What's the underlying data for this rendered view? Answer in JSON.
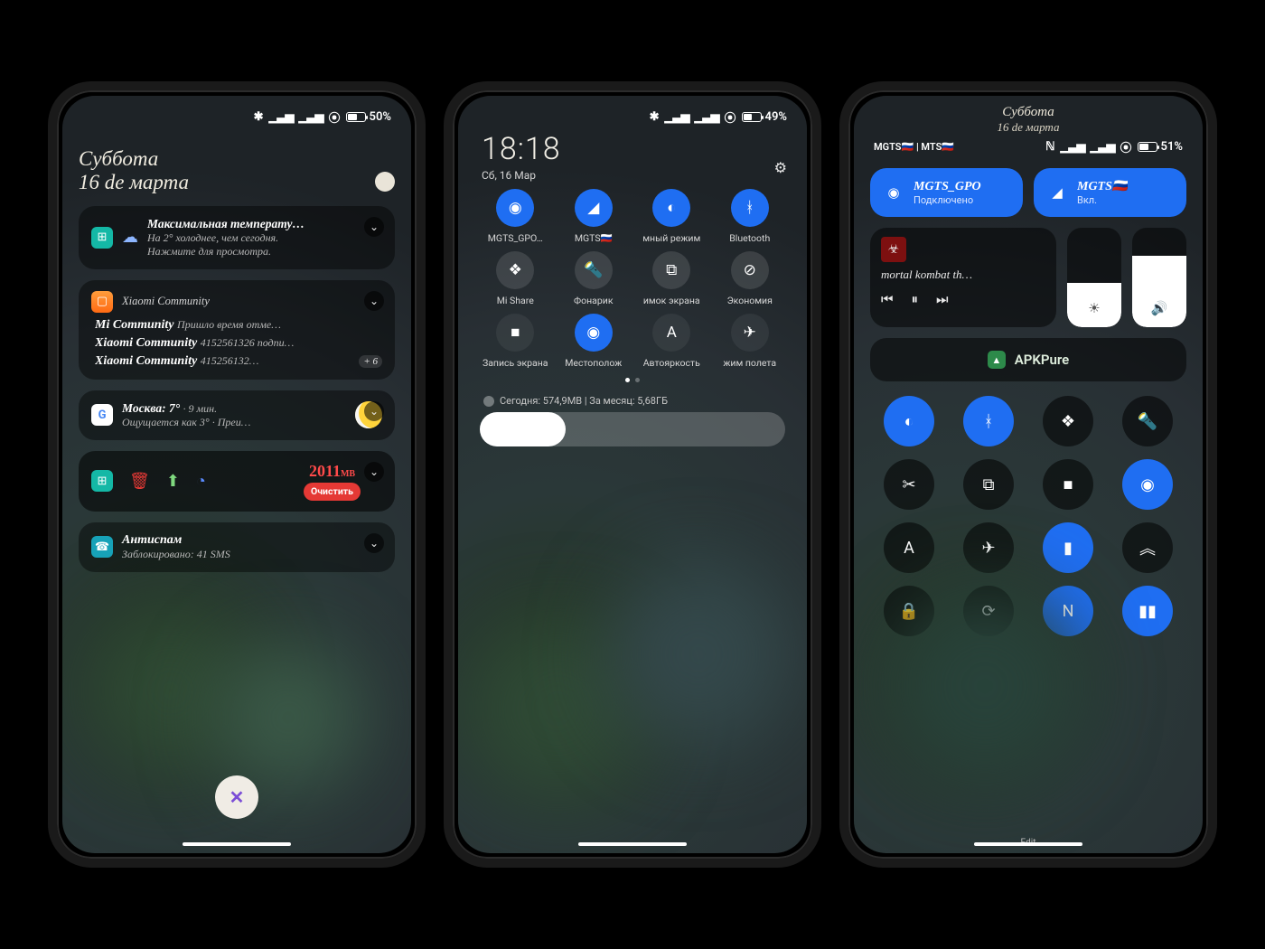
{
  "phone1": {
    "status": {
      "battery": "50%",
      "fill": 50
    },
    "date": {
      "day": "Суббота",
      "line2": "16 de марта"
    },
    "weather_card": {
      "title": "Максимальная температу…",
      "line1": "На 2° холоднее, чем сегодня.",
      "line2": "Нажмите для просмотра."
    },
    "community": {
      "app": "Xiaomi Community",
      "rows": [
        {
          "b": "Mi Community",
          "t": "Пришло время отме…"
        },
        {
          "b": "Xiaomi Community",
          "t": "4152561326 подпи…"
        },
        {
          "b": "Xiaomi Community",
          "t": "415256132…"
        }
      ],
      "more": "+ 6"
    },
    "google": {
      "head": "Москва: 7°",
      "age": "9 мин.",
      "sub": "Ощущается как 3° · Преи…"
    },
    "cleaner": {
      "memory": "2011",
      "unit": "МВ",
      "cta": "Очистить"
    },
    "antispam": {
      "title": "Антиспам",
      "sub": "Заблокировано: 41 SMS"
    }
  },
  "phone2": {
    "clock": "18:18",
    "date": "Сб, 16 Мар",
    "status": {
      "battery": "49%",
      "fill": 49
    },
    "tiles": [
      {
        "icon": "wifi-icon",
        "label": "MGTS_GPO…",
        "state": "on"
      },
      {
        "icon": "signal-icon",
        "label": "MGTS🇷🇺",
        "state": "on"
      },
      {
        "icon": "dark-mode-icon",
        "label": "мный режим",
        "state": "on"
      },
      {
        "icon": "bluetooth-icon",
        "label": "Bluetooth",
        "state": "on"
      },
      {
        "icon": "mishare-icon",
        "label": "Mi Share",
        "state": "off"
      },
      {
        "icon": "flashlight-icon",
        "label": "Фонарик",
        "state": "off"
      },
      {
        "icon": "screenshot-icon",
        "label": "имок экрана",
        "state": "off"
      },
      {
        "icon": "battery-saver-icon",
        "label": "Экономия",
        "state": "off"
      },
      {
        "icon": "screen-record-icon",
        "label": "Запись экрана",
        "state": "muted"
      },
      {
        "icon": "location-icon",
        "label": "Местополож",
        "state": "on"
      },
      {
        "icon": "auto-brightness-icon",
        "label": "Автояркость",
        "state": "muted"
      },
      {
        "icon": "airplane-icon",
        "label": "жим полета",
        "state": "muted"
      }
    ],
    "usage": "Сегодня: 574,9МВ    |    За месяц: 5,68ГБ",
    "brightness_pct": 28
  },
  "phone3": {
    "date": {
      "day": "Суббота",
      "line2": "16 de марта"
    },
    "status": {
      "carriers": "MGTS🇷🇺 | MTS🇷🇺",
      "battery": "51%",
      "fill": 51
    },
    "wifi": {
      "name": "MGTS_GPO",
      "sub": "Подключено"
    },
    "sim": {
      "name": "MGTS🇷🇺",
      "sub": "Вкл."
    },
    "media": {
      "track": "mortal kombat th…"
    },
    "brightness": 45,
    "volume": 72,
    "apk": "APKPure",
    "edit": "Edit",
    "grid": [
      {
        "icon": "dark-mode-icon",
        "state": "on"
      },
      {
        "icon": "bluetooth-icon",
        "state": "on"
      },
      {
        "icon": "mishare-icon",
        "state": "off"
      },
      {
        "icon": "flashlight-icon",
        "state": "off"
      },
      {
        "icon": "scissors-icon",
        "state": "off"
      },
      {
        "icon": "screenshot-icon",
        "state": "off"
      },
      {
        "icon": "screen-record-icon",
        "state": "off"
      },
      {
        "icon": "location-icon",
        "state": "on"
      },
      {
        "icon": "auto-brightness-icon",
        "state": "off"
      },
      {
        "icon": "airplane-icon",
        "state": "off"
      },
      {
        "icon": "files-icon",
        "state": "on"
      },
      {
        "icon": "up-icon",
        "state": "off"
      },
      {
        "icon": "lock-icon",
        "state": "off"
      },
      {
        "icon": "sync-icon",
        "state": "off"
      },
      {
        "icon": "n-icon",
        "state": "on"
      },
      {
        "icon": "split-icon",
        "state": "on"
      }
    ]
  },
  "icons": {
    "chevron-down-icon": "⌄",
    "wifi-icon": "◉",
    "signal-icon": "◢",
    "dark-mode-icon": "◐",
    "bluetooth-icon": "ᚼ",
    "mishare-icon": "❖",
    "flashlight-icon": "🔦",
    "screenshot-icon": "⧉",
    "battery-saver-icon": "⊘",
    "screen-record-icon": "■",
    "location-icon": "◉",
    "auto-brightness-icon": "A",
    "airplane-icon": "✈",
    "scissors-icon": "✂",
    "files-icon": "▮",
    "up-icon": "︽",
    "lock-icon": "🔒",
    "sync-icon": "⟳",
    "n-icon": "N",
    "split-icon": "▮▮",
    "gear-icon": "⚙",
    "prev-icon": "⏮",
    "pause-icon": "⏸",
    "next-icon": "⏭",
    "brightness-icon": "☀",
    "volume-icon": "🔊",
    "cloud-icon": "☁",
    "sun-icon": "☀",
    "nfc-icon": "ℕ"
  }
}
